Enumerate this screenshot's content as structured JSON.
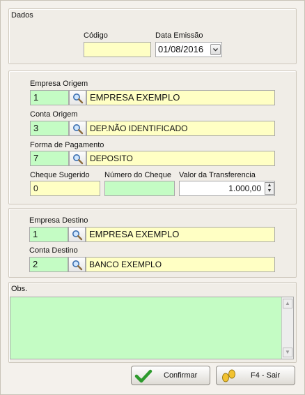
{
  "dados": {
    "title": "Dados",
    "codigo_label": "Código",
    "codigo_value": "",
    "data_emissao_label": "Data Emissão",
    "data_emissao_value": "01/08/2016"
  },
  "origem": {
    "empresa_label": "Empresa Origem",
    "empresa_code": "1",
    "empresa_name": "EMPRESA EXEMPLO",
    "conta_label": "Conta Origem",
    "conta_code": "3",
    "conta_name": "DEP.NÃO IDENTIFICADO",
    "forma_label": "Forma de Pagamento",
    "forma_code": "7",
    "forma_name": "DEPOSITO",
    "cheque_sugerido_label": "Cheque Sugerido",
    "cheque_sugerido_value": "0",
    "numero_cheque_label": "Número do Cheque",
    "numero_cheque_value": "",
    "valor_label": "Valor da Transferencia",
    "valor_value": "1.000,00"
  },
  "destino": {
    "empresa_label": "Empresa Destino",
    "empresa_code": "1",
    "empresa_name": "EMPRESA EXEMPLO",
    "conta_label": "Conta Destino",
    "conta_code": "2",
    "conta_name": "BANCO EXEMPLO"
  },
  "obs": {
    "label": "Obs.",
    "value": ""
  },
  "buttons": {
    "confirmar": "Confirmar",
    "sair": "F4 - Sair"
  },
  "colors": {
    "required_field": "#ffffc4",
    "editable_field": "#c4fcc4",
    "confirm_check": "#2c9a2c"
  },
  "icons": {
    "search": "search-icon",
    "dropdown": "chevron-down-icon",
    "confirm": "check-icon",
    "exit": "footprints-icon"
  }
}
